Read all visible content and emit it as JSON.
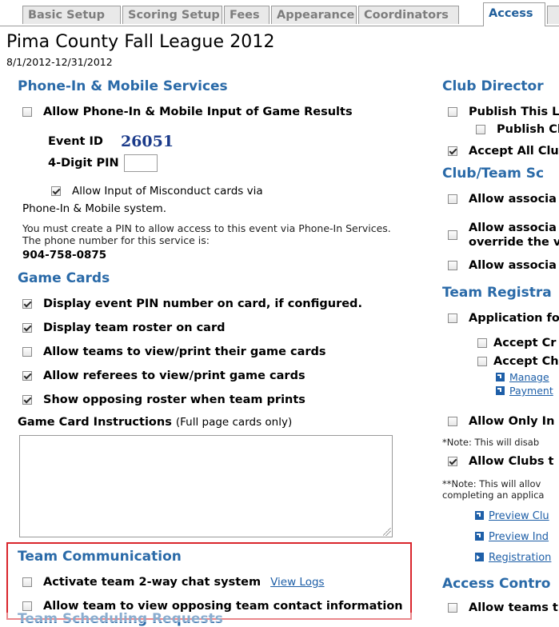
{
  "tabs": [
    {
      "label": "Basic Setup",
      "active": false
    },
    {
      "label": "Scoring Setup",
      "active": false
    },
    {
      "label": "Fees",
      "active": false
    },
    {
      "label": "Appearance",
      "active": false
    },
    {
      "label": "Coordinators",
      "active": false
    },
    {
      "label": "Access",
      "active": true
    },
    {
      "label": "",
      "active": false
    }
  ],
  "event": {
    "title": "Pima County Fall League 2012",
    "dates": "8/1/2012-12/31/2012"
  },
  "phone": {
    "heading": "Phone-In & Mobile Services",
    "allow_label": "Allow Phone-In & Mobile Input of Game Results",
    "event_id_label": "Event ID",
    "event_id_value": "26051",
    "pin_label": "4-Digit PIN",
    "pin_value": "",
    "misconduct_line1": "Allow Input of Misconduct cards via",
    "misconduct_line2": "Phone-In & Mobile system.",
    "note": "You must create a PIN to allow access to this event via Phone-In Services. The phone number for this service is:",
    "phone_number": "904-758-0875"
  },
  "game_cards": {
    "heading": "Game Cards",
    "options": [
      {
        "label": "Display event PIN number on card, if configured.",
        "checked": true
      },
      {
        "label": "Display team roster on card",
        "checked": true
      },
      {
        "label": "Allow teams to view/print their game cards",
        "checked": false
      },
      {
        "label": "Allow referees to view/print game cards",
        "checked": true
      },
      {
        "label": "Show opposing roster when team prints",
        "checked": true
      }
    ],
    "instructions_label": "Game Card Instructions",
    "instructions_hint": "(Full page cards only)",
    "instructions_value": ""
  },
  "team_comm": {
    "heading": "Team Communication",
    "chat_label": "Activate team 2-way chat system",
    "view_logs": "View Logs",
    "contact_label": "Allow team to view opposing team contact information"
  },
  "scheduling": {
    "heading": "Team Scheduling Requests"
  },
  "right": {
    "club_dir_heading": "Club Director",
    "publish_label": "Publish This Le",
    "publish_club_label": "Publish Clu",
    "accept_all_label": "Accept All Clu",
    "club_team_heading": "Club/Team Sc",
    "allow_assoc_1": "Allow associa",
    "allow_assoc_2": "Allow associa",
    "override_line": "override the v",
    "allow_assoc_3": "Allow associa",
    "team_reg_heading": "Team Registra",
    "application_label": "Application fo",
    "accept_cr": "Accept Cr",
    "accept_ch": "Accept Ch",
    "manage_link": "Manage",
    "payment_link": "Payment",
    "allow_only_label": "Allow Only In",
    "note1": "*Note: This will disab",
    "allow_clubs_label": "Allow Clubs t",
    "note2_line1": "**Note: This will allov",
    "note2_line2": "completing an applica",
    "preview_club": "Preview Clu",
    "preview_ind": "Preview Ind",
    "registration": "Registration",
    "access_heading": "Access Contro",
    "allow_teams_label": "Allow teams t"
  },
  "colors": {
    "heading": "#2a6aa8",
    "link": "#1d5ea7",
    "highlight_box": "#d9252c"
  }
}
